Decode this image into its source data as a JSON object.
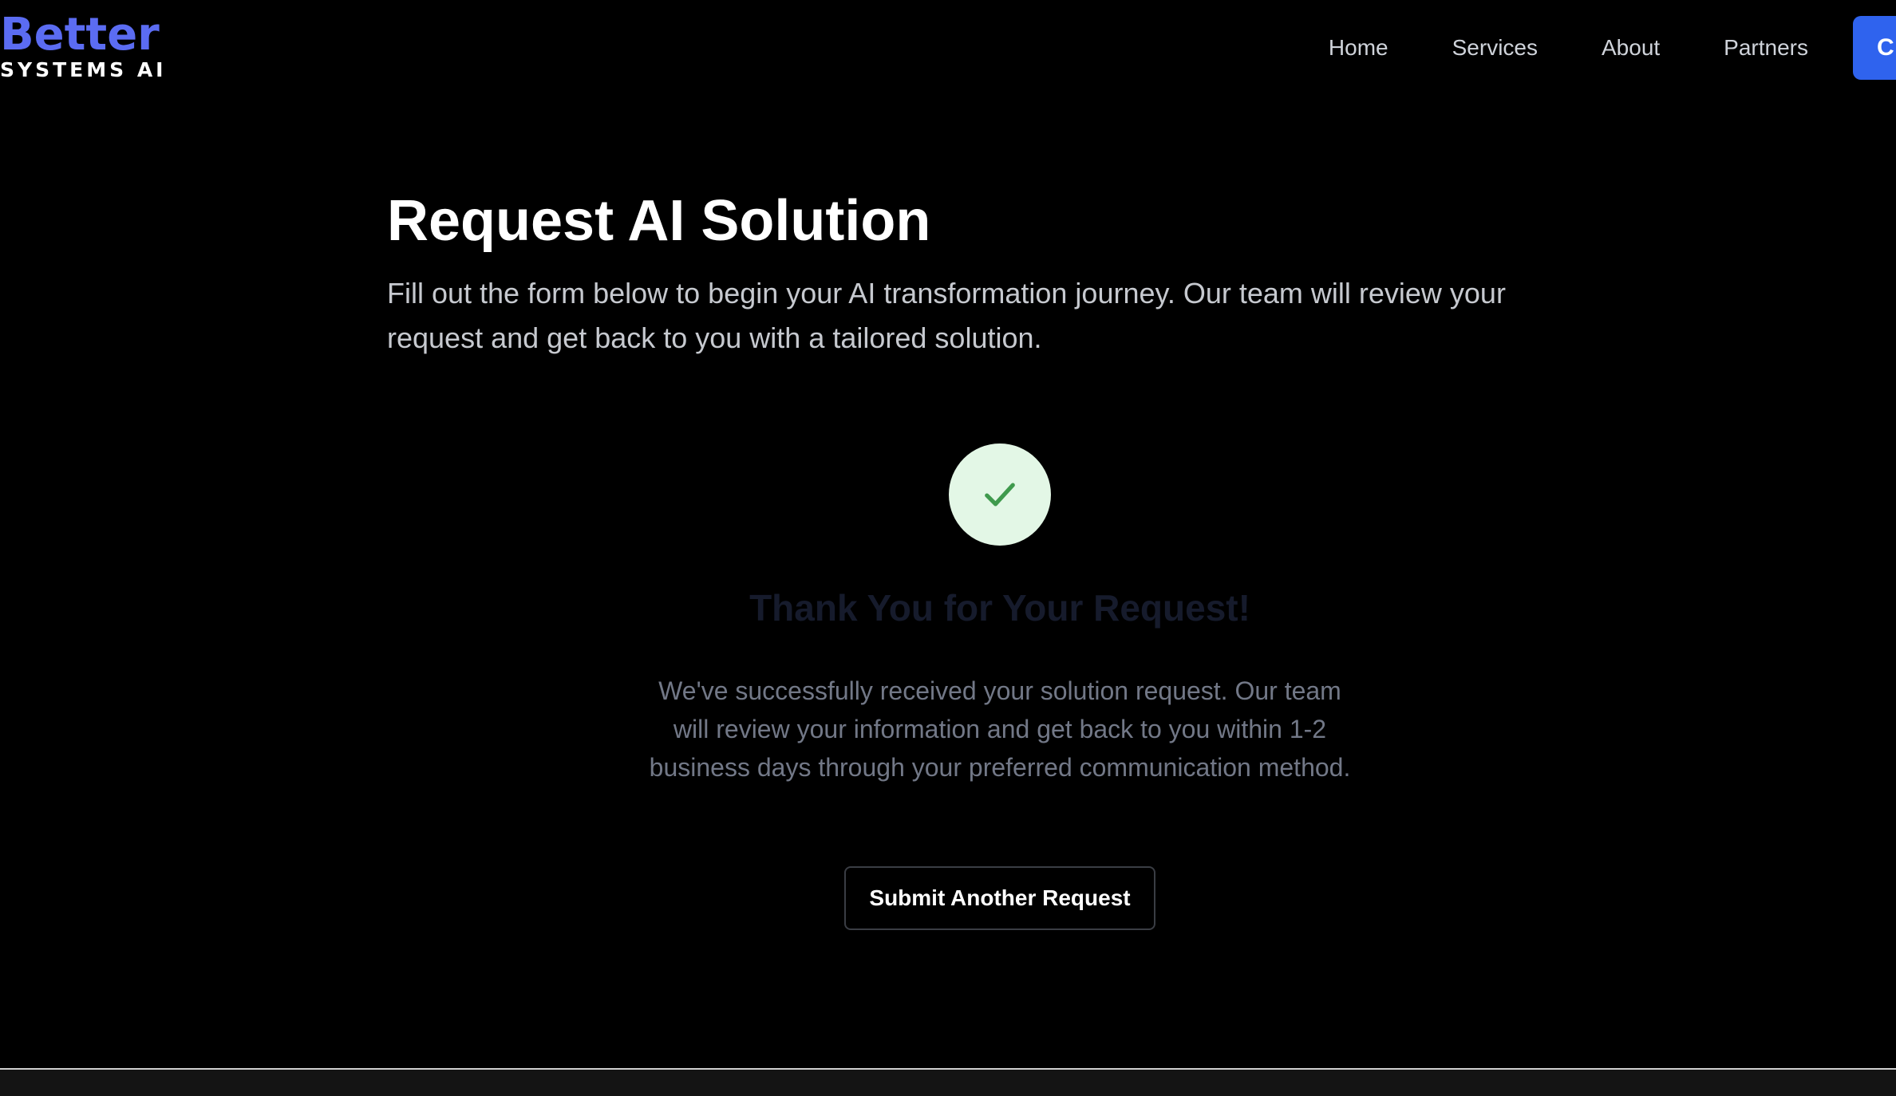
{
  "header": {
    "logo": {
      "primary": "Better",
      "secondary": "SYSTEMS AI"
    },
    "nav": {
      "items": [
        {
          "label": "Home"
        },
        {
          "label": "Services"
        },
        {
          "label": "About"
        },
        {
          "label": "Partners"
        }
      ],
      "cta_label": "C"
    }
  },
  "main": {
    "title": "Request AI Solution",
    "subtitle": "Fill out the form below to begin your AI transformation journey. Our team will review your request and get back to you with a tailored solution."
  },
  "success": {
    "icon": "check-icon",
    "title": "Thank You for Your Request!",
    "message": "We've successfully received your solution request. Our team will review your information and get back to you within 1-2 business days through your preferred communication method.",
    "button_label": "Submit Another Request"
  },
  "colors": {
    "background": "#000000",
    "brand": "#5b6cf2",
    "cta": "#2f63ee",
    "success_circle": "#e3f7e6",
    "success_check": "#3f9a4d"
  }
}
